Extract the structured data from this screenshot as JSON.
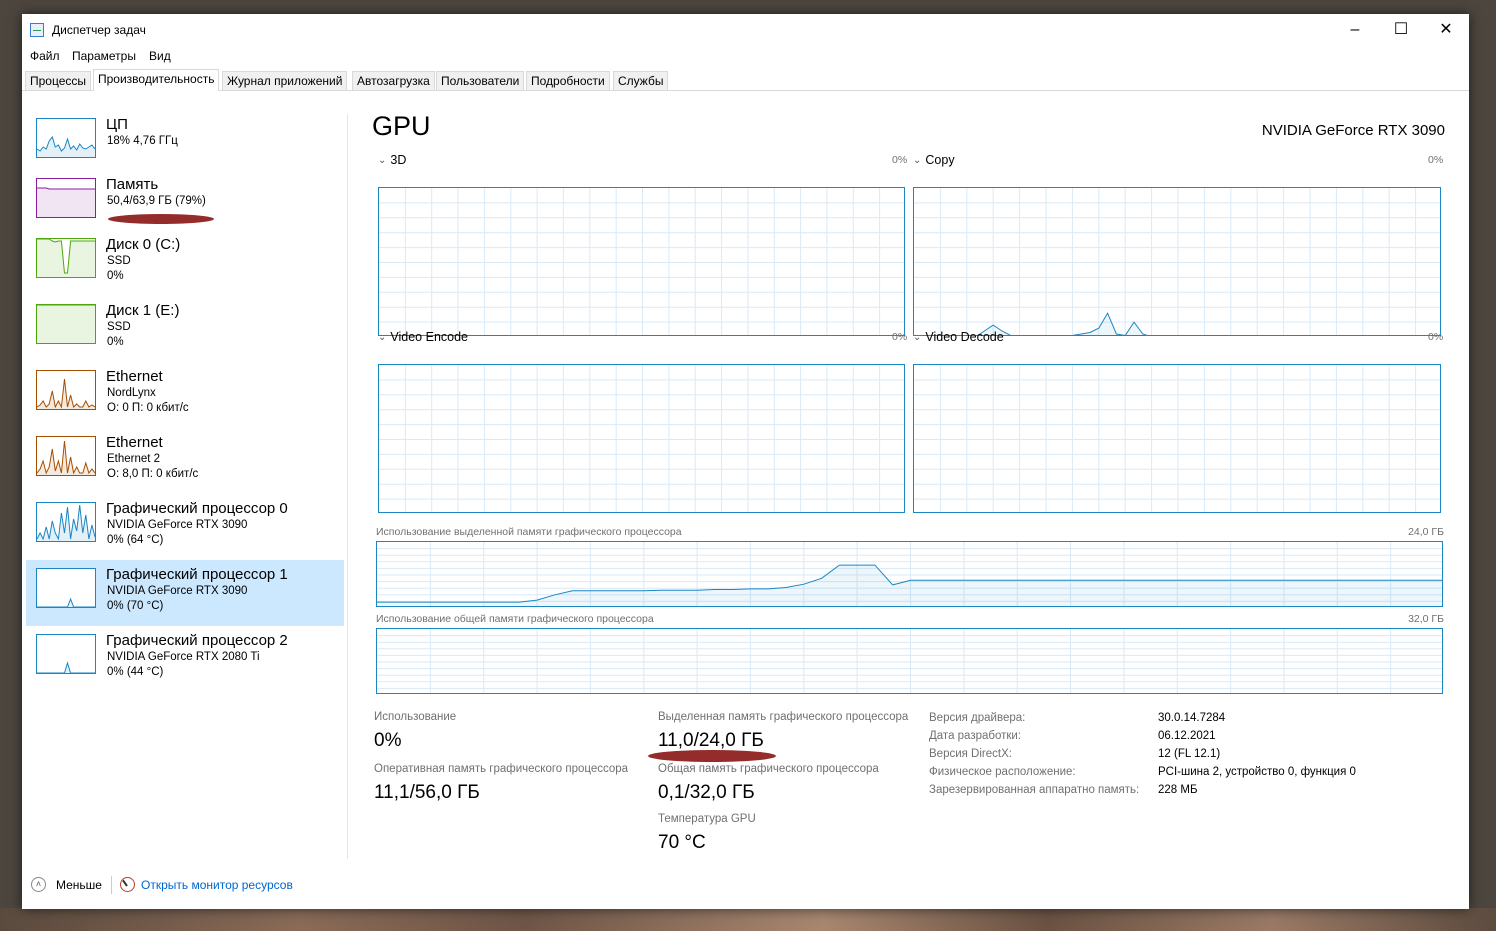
{
  "window": {
    "title": "Диспетчер задач",
    "minimize": "–",
    "maximize": "☐",
    "close": "✕"
  },
  "menu": [
    "Файл",
    "Параметры",
    "Вид"
  ],
  "tabs": [
    "Процессы",
    "Производительность",
    "Журнал приложений",
    "Автозагрузка",
    "Пользователи",
    "Подробности",
    "Службы"
  ],
  "active_tab": "Производительность",
  "sidebar": [
    {
      "title": "ЦП",
      "sub": "18% 4,76 ГГц",
      "sub2": "",
      "color": "#1a86c4",
      "kind": "cpu"
    },
    {
      "title": "Память",
      "sub": "50,4/63,9 ГБ (79%)",
      "sub2": "",
      "color": "#8b1ea0",
      "kind": "mem"
    },
    {
      "title": "Диск 0 (C:)",
      "sub": "SSD",
      "sub2": "0%",
      "color": "#4da60c",
      "kind": "disk0"
    },
    {
      "title": "Диск 1 (E:)",
      "sub": "SSD",
      "sub2": "0%",
      "color": "#4da60c",
      "kind": "disk1"
    },
    {
      "title": "Ethernet",
      "sub": "NordLynx",
      "sub2": "О: 0 П: 0 кбит/с",
      "color": "#a74f01",
      "kind": "net1"
    },
    {
      "title": "Ethernet",
      "sub": "Ethernet 2",
      "sub2": "О: 8,0 П: 0 кбит/с",
      "color": "#a74f01",
      "kind": "net2"
    },
    {
      "title": "Графический процессор 0",
      "sub": "NVIDIA GeForce RTX 3090",
      "sub2": "0% (64 °C)",
      "color": "#1a86c4",
      "kind": "gpu0"
    },
    {
      "title": "Графический процессор 1",
      "sub": "NVIDIA GeForce RTX 3090",
      "sub2": "0% (70 °C)",
      "color": "#1a86c4",
      "kind": "gpu1",
      "selected": true
    },
    {
      "title": "Графический процессор 2",
      "sub": "NVIDIA GeForce RTX 2080 Ti",
      "sub2": "0% (44 °C)",
      "color": "#1a86c4",
      "kind": "gpu2"
    }
  ],
  "gpu": {
    "title": "GPU",
    "model": "NVIDIA GeForce RTX 3090",
    "engines": [
      {
        "name": "3D",
        "percent": "0%"
      },
      {
        "name": "Copy",
        "percent": "0%"
      },
      {
        "name": "Video Encode",
        "percent": "0%"
      },
      {
        "name": "Video Decode",
        "percent": "0%"
      }
    ],
    "dedicated_mem_graph": {
      "label": "Использование выделенной памяти графического процессора",
      "max": "24,0 ГБ"
    },
    "shared_mem_graph": {
      "label": "Использование общей памяти графического процессора",
      "max": "32,0 ГБ"
    },
    "stats": {
      "usage_label": "Использование",
      "usage_value": "0%",
      "dedicated_label": "Выделенная память графического процессора",
      "dedicated_value": "11,0/24,0 ГБ",
      "gpu_mem_label": "Оперативная память графического процессора",
      "gpu_mem_value": "11,1/56,0 ГБ",
      "shared_label": "Общая память графического процессора",
      "shared_value": "0,1/32,0 ГБ",
      "temp_label": "Температура GPU",
      "temp_value": "70 °C"
    },
    "info": [
      {
        "key": "Версия драйвера:",
        "value": "30.0.14.7284"
      },
      {
        "key": "Дата разработки:",
        "value": "06.12.2021"
      },
      {
        "key": "Версия DirectX:",
        "value": "12 (FL 12.1)"
      },
      {
        "key": "Физическое расположение:",
        "value": "PCI-шина 2, устройство 0, функция 0"
      },
      {
        "key": "Зарезервированная аппаратно память:",
        "value": "228 МБ"
      }
    ]
  },
  "footer": {
    "less_label": "Меньше",
    "resource_monitor_link": "Открыть монитор ресурсов"
  }
}
